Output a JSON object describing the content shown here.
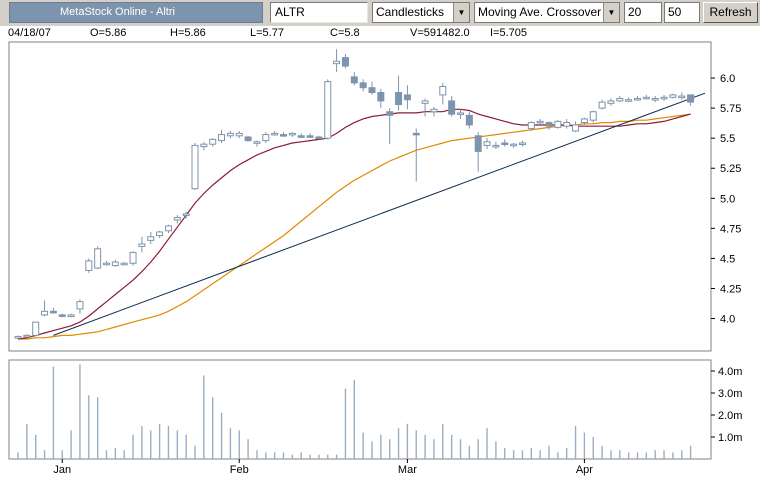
{
  "toolbar": {
    "title": "MetaStock Online - Altri",
    "symbol": "ALTR",
    "chart_style": "Candlesticks",
    "indicator": "Moving Ave. Crossover",
    "period1": "20",
    "period2": "50",
    "refresh_label": "Refresh"
  },
  "info": {
    "date": "04/18/07",
    "open": "O=5.86",
    "high": "H=5.86",
    "low": "L=5.77",
    "close": "C=5.8",
    "volume": "V=591482.0",
    "indicator": "I=5.705"
  },
  "colors": {
    "candle": "#7c94ad",
    "ma_short": "#8b1a3a",
    "ma_long": "#e08a00",
    "trendline": "#0a2a50",
    "volume": "#9aaec2"
  },
  "chart_data": {
    "type": "candlestick",
    "price_axis": {
      "ylim": [
        3.73,
        6.3
      ],
      "ticks": [
        "6.0",
        "5.75",
        "5.5",
        "5.25",
        "5.0",
        "4.75",
        "4.5",
        "4.25",
        "4.0"
      ],
      "tick_values": [
        6.0,
        5.75,
        5.5,
        5.25,
        5.0,
        4.75,
        4.5,
        4.25,
        4.0
      ]
    },
    "volume_axis": {
      "ylim": [
        0,
        4.5
      ],
      "ticks": [
        "4.0m",
        "3.0m",
        "2.0m",
        "1.0m"
      ],
      "tick_values": [
        4.0,
        3.0,
        2.0,
        1.0
      ]
    },
    "months": [
      {
        "label": "Jan",
        "index": 5
      },
      {
        "label": "Feb",
        "index": 25
      },
      {
        "label": "Mar",
        "index": 44
      },
      {
        "label": "Apr",
        "index": 64
      }
    ],
    "grid": false,
    "candles": [
      [
        3.84,
        3.86,
        3.83,
        3.85
      ],
      [
        3.85,
        3.87,
        3.84,
        3.86
      ],
      [
        3.86,
        3.97,
        3.85,
        3.97
      ],
      [
        4.03,
        4.15,
        4.02,
        4.06
      ],
      [
        4.06,
        4.09,
        4.04,
        4.05
      ],
      [
        4.03,
        4.04,
        4.01,
        4.02
      ],
      [
        4.03,
        4.04,
        4.01,
        4.03
      ],
      [
        4.08,
        4.16,
        4.04,
        4.14
      ],
      [
        4.4,
        4.5,
        4.38,
        4.48
      ],
      [
        4.42,
        4.6,
        4.41,
        4.58
      ],
      [
        4.45,
        4.48,
        4.44,
        4.46
      ],
      [
        4.44,
        4.49,
        4.43,
        4.47
      ],
      [
        4.45,
        4.47,
        4.44,
        4.46
      ],
      [
        4.46,
        4.56,
        4.44,
        4.55
      ],
      [
        4.6,
        4.68,
        4.55,
        4.62
      ],
      [
        4.65,
        4.72,
        4.62,
        4.68
      ],
      [
        4.69,
        4.73,
        4.67,
        4.72
      ],
      [
        4.73,
        4.78,
        4.71,
        4.77
      ],
      [
        4.82,
        4.86,
        4.79,
        4.84
      ],
      [
        4.86,
        4.89,
        4.83,
        4.87
      ],
      [
        5.08,
        5.46,
        5.07,
        5.44
      ],
      [
        5.43,
        5.47,
        5.4,
        5.45
      ],
      [
        5.45,
        5.5,
        5.43,
        5.49
      ],
      [
        5.48,
        5.57,
        5.46,
        5.53
      ],
      [
        5.52,
        5.56,
        5.5,
        5.54
      ],
      [
        5.52,
        5.56,
        5.5,
        5.54
      ],
      [
        5.51,
        5.52,
        5.47,
        5.48
      ],
      [
        5.46,
        5.48,
        5.43,
        5.47
      ],
      [
        5.48,
        5.55,
        5.46,
        5.53
      ],
      [
        5.54,
        5.56,
        5.52,
        5.54
      ],
      [
        5.53,
        5.55,
        5.51,
        5.52
      ],
      [
        5.53,
        5.55,
        5.51,
        5.54
      ],
      [
        5.52,
        5.54,
        5.5,
        5.51
      ],
      [
        5.52,
        5.54,
        5.5,
        5.51
      ],
      [
        5.51,
        5.52,
        5.49,
        5.5
      ],
      [
        5.5,
        5.99,
        5.49,
        5.97
      ],
      [
        6.12,
        6.24,
        6.05,
        6.14
      ],
      [
        6.17,
        6.2,
        6.08,
        6.1
      ],
      [
        6.01,
        6.05,
        5.94,
        5.96
      ],
      [
        5.96,
        5.99,
        5.89,
        5.92
      ],
      [
        5.92,
        5.97,
        5.86,
        5.88
      ],
      [
        5.88,
        5.91,
        5.75,
        5.81
      ],
      [
        5.72,
        5.75,
        5.45,
        5.69
      ],
      [
        5.88,
        6.02,
        5.73,
        5.78
      ],
      [
        5.86,
        5.94,
        5.74,
        5.82
      ],
      [
        5.54,
        5.58,
        5.14,
        5.53
      ],
      [
        5.79,
        5.83,
        5.68,
        5.81
      ],
      [
        5.72,
        5.76,
        5.68,
        5.74
      ],
      [
        5.86,
        5.96,
        5.78,
        5.93
      ],
      [
        5.81,
        5.85,
        5.68,
        5.7
      ],
      [
        5.7,
        5.74,
        5.66,
        5.71
      ],
      [
        5.69,
        5.72,
        5.58,
        5.61
      ],
      [
        5.52,
        5.55,
        5.22,
        5.39
      ],
      [
        5.44,
        5.5,
        5.41,
        5.47
      ],
      [
        5.43,
        5.47,
        5.41,
        5.44
      ],
      [
        5.46,
        5.49,
        5.43,
        5.45
      ],
      [
        5.44,
        5.46,
        5.42,
        5.45
      ],
      [
        5.45,
        5.48,
        5.43,
        5.46
      ],
      [
        5.58,
        5.64,
        5.56,
        5.63
      ],
      [
        5.63,
        5.66,
        5.6,
        5.64
      ],
      [
        5.63,
        5.64,
        5.57,
        5.6
      ],
      [
        5.59,
        5.65,
        5.58,
        5.64
      ],
      [
        5.6,
        5.66,
        5.58,
        5.63
      ],
      [
        5.56,
        5.64,
        5.55,
        5.61
      ],
      [
        5.63,
        5.67,
        5.61,
        5.66
      ],
      [
        5.65,
        5.73,
        5.63,
        5.72
      ],
      [
        5.75,
        5.82,
        5.74,
        5.8
      ],
      [
        5.79,
        5.83,
        5.77,
        5.81
      ],
      [
        5.81,
        5.85,
        5.8,
        5.83
      ],
      [
        5.82,
        5.84,
        5.8,
        5.82
      ],
      [
        5.82,
        5.85,
        5.81,
        5.83
      ],
      [
        5.83,
        5.86,
        5.82,
        5.84
      ],
      [
        5.82,
        5.85,
        5.8,
        5.83
      ],
      [
        5.83,
        5.86,
        5.81,
        5.84
      ],
      [
        5.84,
        5.87,
        5.83,
        5.86
      ],
      [
        5.84,
        5.88,
        5.82,
        5.85
      ],
      [
        5.86,
        5.86,
        5.77,
        5.8
      ]
    ],
    "ma_short": [
      3.83,
      3.84,
      3.86,
      3.88,
      3.9,
      3.92,
      3.94,
      3.97,
      4.02,
      4.08,
      4.14,
      4.2,
      4.26,
      4.32,
      4.39,
      4.47,
      4.56,
      4.66,
      4.76,
      4.86,
      4.96,
      5.04,
      5.11,
      5.17,
      5.23,
      5.28,
      5.32,
      5.36,
      5.39,
      5.42,
      5.44,
      5.46,
      5.47,
      5.48,
      5.49,
      5.5,
      5.54,
      5.59,
      5.63,
      5.66,
      5.68,
      5.69,
      5.7,
      5.71,
      5.71,
      5.71,
      5.72,
      5.72,
      5.72,
      5.74,
      5.74,
      5.73,
      5.7,
      5.68,
      5.66,
      5.64,
      5.62,
      5.61,
      5.61,
      5.61,
      5.61,
      5.61,
      5.61,
      5.6,
      5.6,
      5.6,
      5.6,
      5.6,
      5.6,
      5.61,
      5.62,
      5.62,
      5.63,
      5.64,
      5.66,
      5.68,
      5.7
    ],
    "ma_long": [
      3.83,
      3.83,
      3.84,
      3.84,
      3.85,
      3.86,
      3.86,
      3.87,
      3.88,
      3.89,
      3.91,
      3.93,
      3.95,
      3.97,
      3.99,
      4.01,
      4.03,
      4.06,
      4.1,
      4.14,
      4.19,
      4.24,
      4.29,
      4.34,
      4.39,
      4.44,
      4.49,
      4.54,
      4.59,
      4.64,
      4.69,
      4.75,
      4.81,
      4.87,
      4.93,
      4.99,
      5.05,
      5.1,
      5.15,
      5.19,
      5.23,
      5.27,
      5.31,
      5.34,
      5.37,
      5.4,
      5.42,
      5.44,
      5.46,
      5.48,
      5.49,
      5.5,
      5.51,
      5.52,
      5.53,
      5.54,
      5.55,
      5.56,
      5.57,
      5.58,
      5.59,
      5.6,
      5.61,
      5.61,
      5.62,
      5.62,
      5.63,
      5.63,
      5.64,
      5.64,
      5.65,
      5.65,
      5.66,
      5.67,
      5.68,
      5.69,
      5.7
    ],
    "trendline": [
      [
        4,
        3.86
      ],
      [
        76,
        5.83
      ]
    ],
    "volume": [
      0.3,
      1.6,
      1.1,
      0.4,
      4.2,
      0.4,
      1.3,
      4.3,
      2.9,
      2.8,
      0.4,
      0.5,
      0.4,
      1.1,
      1.5,
      1.3,
      1.6,
      1.5,
      1.3,
      1.1,
      0.6,
      3.8,
      2.8,
      2.1,
      1.4,
      1.3,
      0.9,
      0.4,
      0.3,
      0.3,
      0.3,
      0.2,
      0.3,
      0.2,
      0.2,
      0.2,
      0.2,
      3.2,
      3.6,
      1.2,
      0.8,
      1.1,
      0.9,
      1.4,
      1.6,
      1.3,
      1.1,
      0.9,
      1.6,
      1.1,
      0.9,
      0.6,
      0.9,
      1.4,
      0.8,
      0.5,
      0.4,
      0.4,
      0.5,
      0.4,
      0.6,
      0.3,
      0.5,
      1.5,
      1.2,
      1.0,
      0.6,
      0.4,
      0.4,
      0.3,
      0.3,
      0.3,
      0.4,
      0.4,
      0.3,
      0.4,
      0.6
    ]
  }
}
